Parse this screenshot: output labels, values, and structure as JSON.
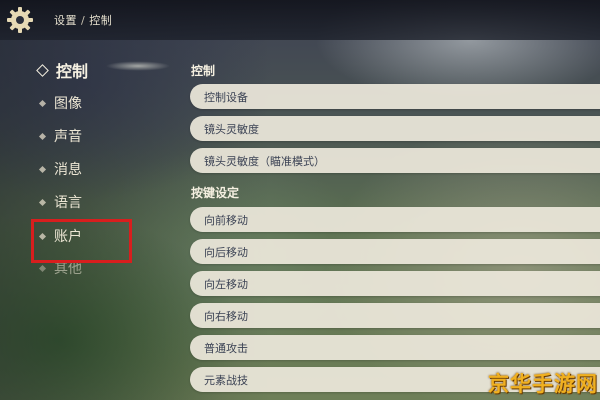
{
  "header": {
    "breadcrumb_root": "设置",
    "breadcrumb_separator": "/",
    "breadcrumb_current": "控制",
    "gear_icon": "gear-icon"
  },
  "sidebar": {
    "items": [
      {
        "label": "控制",
        "active": true
      },
      {
        "label": "图像",
        "active": false
      },
      {
        "label": "声音",
        "active": false
      },
      {
        "label": "消息",
        "active": false
      },
      {
        "label": "语言",
        "active": false
      },
      {
        "label": "账户",
        "active": false
      },
      {
        "label": "其他",
        "active": false
      }
    ],
    "highlighted_item": "账户",
    "highlight_color": "#d81e1e"
  },
  "main": {
    "sections": [
      {
        "title": "控制",
        "rows": [
          "控制设备",
          "镜头灵敏度",
          "镜头灵敏度（瞄准模式）"
        ]
      },
      {
        "title": "按键设定",
        "rows": [
          "向前移动",
          "向后移动",
          "向左移动",
          "向右移动",
          "普通攻击",
          "元素战技"
        ]
      }
    ]
  },
  "watermark": {
    "text": "京华手游网",
    "color": "#f0b020"
  }
}
